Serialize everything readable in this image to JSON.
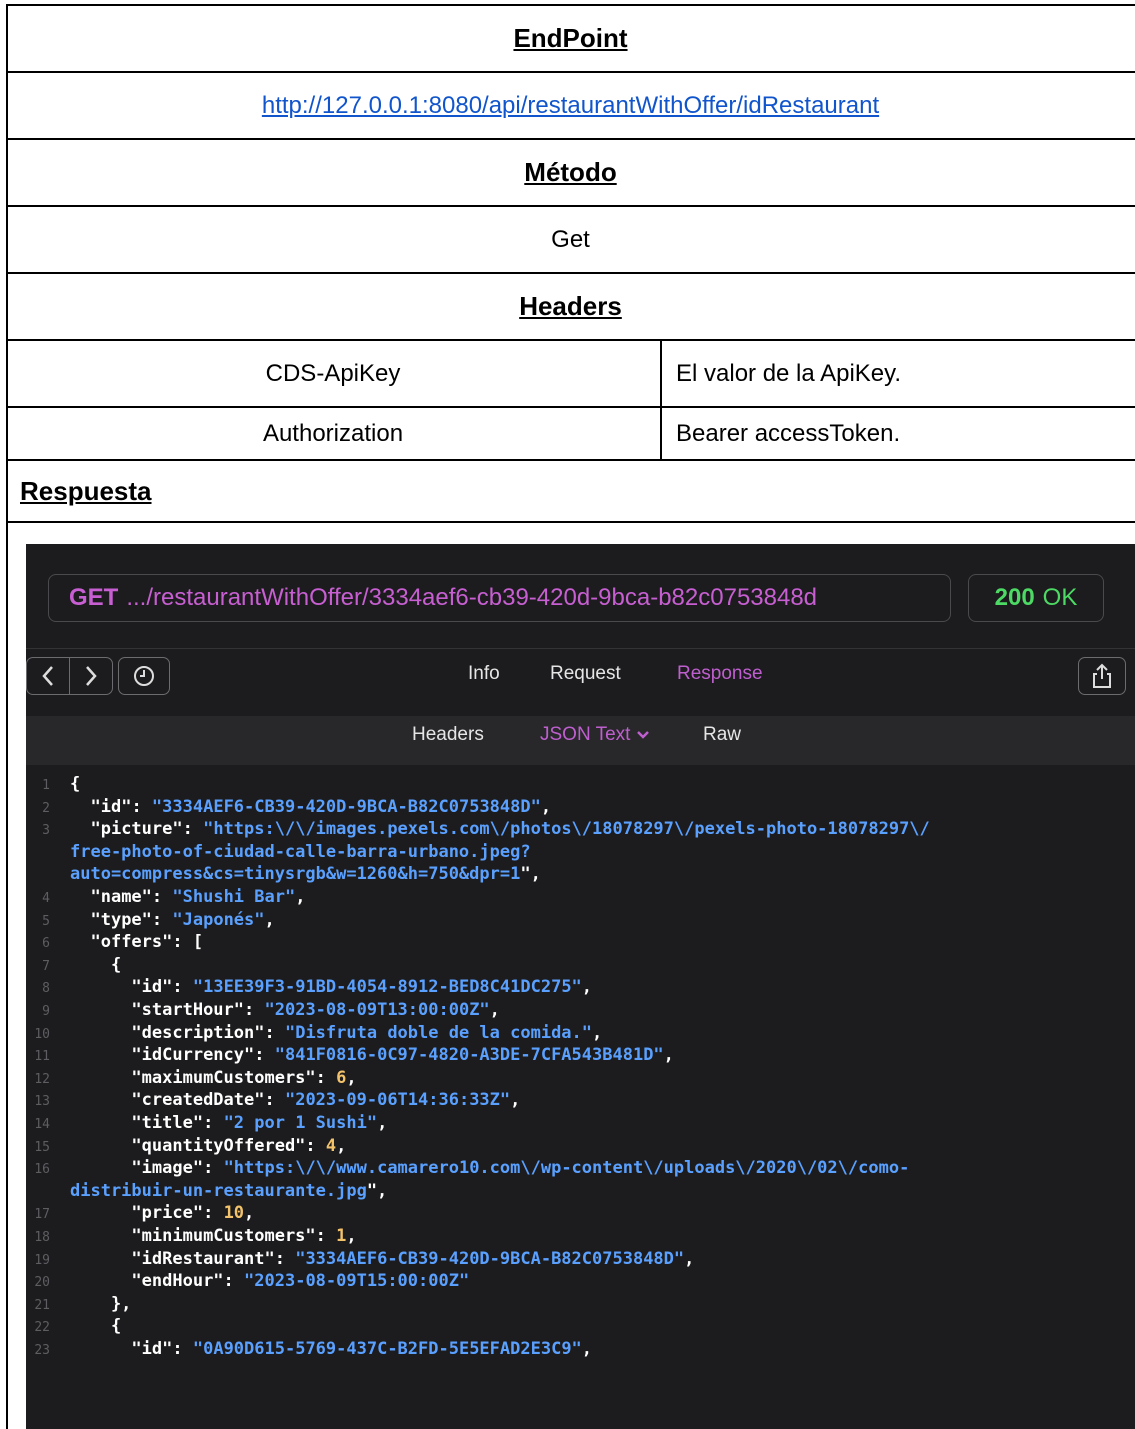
{
  "endpoint_header": "EndPoint",
  "endpoint_url": "http://127.0.0.1:8080/api/restaurantWithOffer/idRestaurant",
  "method_header": "Método",
  "method_value": "Get",
  "headers_header": "Headers",
  "headers": [
    {
      "name": "CDS-ApiKey",
      "value": "El valor de la ApiKey."
    },
    {
      "name": "Authorization",
      "value": "Bearer accessToken."
    }
  ],
  "response_header": "Respuesta",
  "screenshot": {
    "method": "GET",
    "url": ".../restaurantWithOffer/3334aef6-cb39-420d-9bca-b82c0753848d",
    "status_code": "200",
    "status_text": "OK",
    "tabs": [
      "Info",
      "Request",
      "Response"
    ],
    "active_tab": "Response",
    "subtabs": [
      "Headers",
      "JSON Text",
      "Raw"
    ],
    "active_subtab": "JSON Text",
    "code_lines": [
      {
        "n": "1",
        "t": "{"
      },
      {
        "n": "2",
        "t": "  \"id\": \"3334AEF6-CB39-420D-9BCA-B82C0753848D\","
      },
      {
        "n": "3",
        "t": "  \"picture\": \"https:\\/\\/images.pexels.com\\/photos\\/18078297\\/pexels-photo-18078297\\/"
      },
      {
        "n": "",
        "t": "free-photo-of-ciudad-calle-barra-urbano.jpeg?"
      },
      {
        "n": "",
        "t": "auto=compress&cs=tinysrgb&w=1260&h=750&dpr=1\","
      },
      {
        "n": "4",
        "t": "  \"name\": \"Shushi Bar\","
      },
      {
        "n": "5",
        "t": "  \"type\": \"Japonés\","
      },
      {
        "n": "6",
        "t": "  \"offers\": ["
      },
      {
        "n": "7",
        "t": "    {"
      },
      {
        "n": "8",
        "t": "      \"id\": \"13EE39F3-91BD-4054-8912-BED8C41DC275\","
      },
      {
        "n": "9",
        "t": "      \"startHour\": \"2023-08-09T13:00:00Z\","
      },
      {
        "n": "10",
        "t": "      \"description\": \"Disfruta doble de la comida.\","
      },
      {
        "n": "11",
        "t": "      \"idCurrency\": \"841F0816-0C97-4820-A3DE-7CFA543B481D\","
      },
      {
        "n": "12",
        "t": "      \"maximumCustomers\": 6,"
      },
      {
        "n": "13",
        "t": "      \"createdDate\": \"2023-09-06T14:36:33Z\","
      },
      {
        "n": "14",
        "t": "      \"title\": \"2 por 1 Sushi\","
      },
      {
        "n": "15",
        "t": "      \"quantityOffered\": 4,"
      },
      {
        "n": "16",
        "t": "      \"image\": \"https:\\/\\/www.camarero10.com\\/wp-content\\/uploads\\/2020\\/02\\/como-"
      },
      {
        "n": "",
        "t": "distribuir-un-restaurante.jpg\","
      },
      {
        "n": "17",
        "t": "      \"price\": 10,"
      },
      {
        "n": "18",
        "t": "      \"minimumCustomers\": 1,"
      },
      {
        "n": "19",
        "t": "      \"idRestaurant\": \"3334AEF6-CB39-420D-9BCA-B82C0753848D\","
      },
      {
        "n": "20",
        "t": "      \"endHour\": \"2023-08-09T15:00:00Z\""
      },
      {
        "n": "21",
        "t": "    },"
      },
      {
        "n": "22",
        "t": "    {"
      },
      {
        "n": "23",
        "t": "      \"id\": \"0A90D615-5769-437C-B2FD-5E5EFAD2E3C9\","
      }
    ]
  },
  "colors": {
    "link": "#1155cc",
    "method_purple": "#c75fd2",
    "status_green": "#4cd964",
    "string_blue": "#5aa0ff",
    "number_yellow": "#f3c36b",
    "bg_dark": "#1c1c1e"
  }
}
